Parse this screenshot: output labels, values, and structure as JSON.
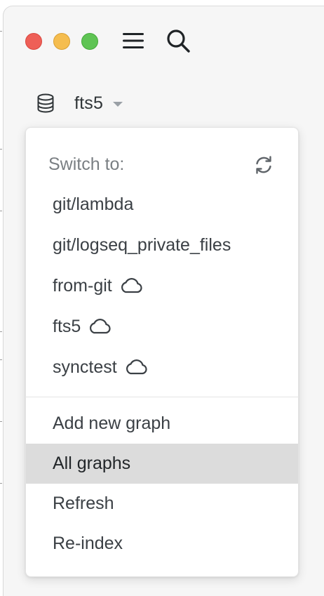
{
  "window": {
    "traffic_lights": {
      "close_color": "#ee5f57",
      "minimize_color": "#f5bd4f",
      "zoom_color": "#5fc454"
    }
  },
  "toolbar": {
    "menu_icon": "hamburger-icon",
    "search_icon": "search-icon"
  },
  "graph_selector": {
    "icon": "database-icon",
    "current_graph": "fts5",
    "caret_icon": "caret-down-icon"
  },
  "dropdown": {
    "header": "Switch to:",
    "refresh_icon": "refresh-icon",
    "graphs": [
      {
        "name": "git/lambda",
        "cloud": false
      },
      {
        "name": "git/logseq_private_files",
        "cloud": false
      },
      {
        "name": "from-git",
        "cloud": true
      },
      {
        "name": "fts5",
        "cloud": true
      },
      {
        "name": "synctest",
        "cloud": true
      }
    ],
    "actions": [
      {
        "label": "Add new graph",
        "active": false
      },
      {
        "label": "All graphs",
        "active": true
      },
      {
        "label": "Refresh",
        "active": false
      },
      {
        "label": "Re-index",
        "active": false
      }
    ],
    "active_item_color": "#dcdcdc"
  }
}
